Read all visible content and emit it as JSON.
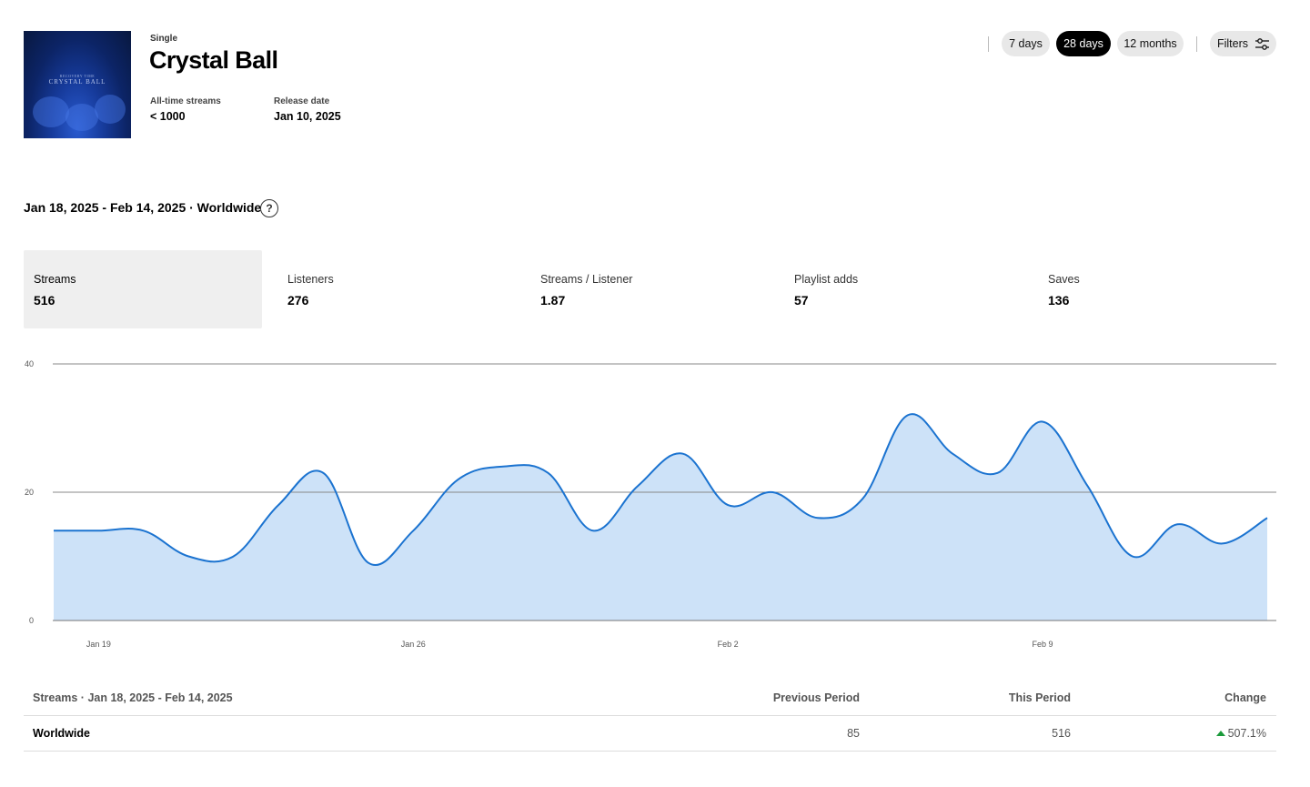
{
  "header": {
    "type_label": "Single",
    "title": "Crystal Ball",
    "cover_small": "RECOVERY TIME",
    "cover_title": "CRYSTAL BALL",
    "all_time_streams_label": "All-time streams",
    "all_time_streams_value": "< 1000",
    "release_date_label": "Release date",
    "release_date_value": "Jan 10, 2025"
  },
  "range_controls": {
    "options": [
      "7 days",
      "28 days",
      "12 months"
    ],
    "selected": "28 days",
    "filters_label": "Filters",
    "filters_icon": "sliders-icon"
  },
  "period_line": {
    "text": "Jan 18, 2025 - Feb 14, 2025 · Worldwide",
    "help_icon": "question-icon",
    "help_glyph": "?"
  },
  "metrics": [
    {
      "label": "Streams",
      "value": "516",
      "active": true
    },
    {
      "label": "Listeners",
      "value": "276",
      "active": false
    },
    {
      "label": "Streams / Listener",
      "value": "1.87",
      "active": false
    },
    {
      "label": "Playlist adds",
      "value": "57",
      "active": false
    },
    {
      "label": "Saves",
      "value": "136",
      "active": false
    }
  ],
  "chart_data": {
    "type": "area",
    "x": [
      "Jan 18",
      "Jan 19",
      "Jan 20",
      "Jan 21",
      "Jan 22",
      "Jan 23",
      "Jan 24",
      "Jan 25",
      "Jan 26",
      "Jan 27",
      "Jan 28",
      "Jan 29",
      "Jan 30",
      "Jan 31",
      "Feb 1",
      "Feb 2",
      "Feb 3",
      "Feb 4",
      "Feb 5",
      "Feb 6",
      "Feb 7",
      "Feb 8",
      "Feb 9",
      "Feb 10",
      "Feb 11",
      "Feb 12",
      "Feb 13",
      "Feb 14"
    ],
    "values": [
      14,
      14,
      14,
      10,
      10,
      18,
      23,
      9,
      14,
      22,
      24,
      23,
      14,
      21,
      26,
      18,
      20,
      16,
      19,
      32,
      26,
      23,
      31,
      21,
      10,
      15,
      12,
      16
    ],
    "x_ticks": [
      "Jan 19",
      "Jan 26",
      "Feb 2",
      "Feb 9"
    ],
    "y_ticks": [
      0,
      20,
      40
    ],
    "ylim": [
      0,
      40
    ],
    "grid": true,
    "line_color": "#1b73d0",
    "fill_color": "#cde2f8"
  },
  "table": {
    "header": {
      "title": "Streams · Jan 18, 2025 - Feb 14, 2025",
      "previous_period": "Previous Period",
      "this_period": "This Period",
      "change": "Change"
    },
    "rows": [
      {
        "region": "Worldwide",
        "previous": "85",
        "current": "516",
        "change": "507.1%",
        "trend": "up",
        "trend_color": "#1a9a3a"
      }
    ]
  }
}
